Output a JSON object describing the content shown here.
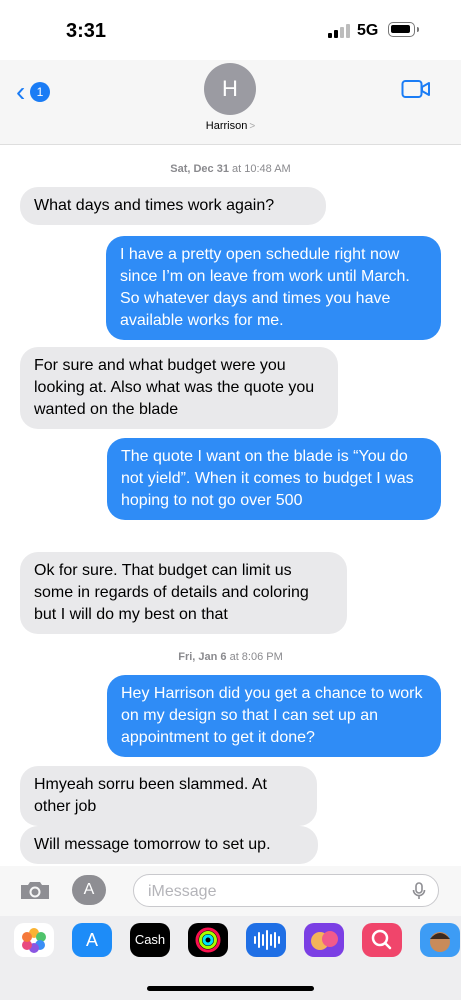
{
  "status": {
    "time": "3:31",
    "network": "5G"
  },
  "nav": {
    "back_badge": "1",
    "avatar_initial": "H",
    "contact_name": "Harrison",
    "contact_chevron": ">"
  },
  "messages": [
    {
      "type": "stamp",
      "day": "Sat, Dec 31",
      "time": "at 10:48 AM"
    },
    {
      "type": "in",
      "text": "What days and times work again?"
    },
    {
      "type": "out",
      "text": "I have a pretty open schedule right now since I’m on leave from work until March. So whatever days and times you have available works for me."
    },
    {
      "type": "in",
      "text": "For sure and what budget were you looking at. Also what was the quote you wanted on the blade"
    },
    {
      "type": "out",
      "text": "The quote I want on the blade is “You do not yield”. When it comes to budget I was hoping to not go over 500"
    },
    {
      "type": "in",
      "text": "Ok for sure. That budget can limit us some in regards of details and coloring but I will do my best on that"
    },
    {
      "type": "stamp",
      "day": "Fri, Jan 6",
      "time": "at 8:06 PM"
    },
    {
      "type": "out",
      "text": "Hey Harrison did you get a chance to work on my design so that I can set up an appointment to get it done?"
    },
    {
      "type": "in",
      "text": "Hmyeah sorru been slammed. At other job"
    },
    {
      "type": "in",
      "text": "Will message tomorrow to set up."
    }
  ],
  "input": {
    "placeholder": "iMessage",
    "value": ""
  },
  "apps": [
    {
      "name": "photos-icon"
    },
    {
      "name": "app-store-icon"
    },
    {
      "name": "apple-cash-icon",
      "label": "Cash"
    },
    {
      "name": "activity-icon"
    },
    {
      "name": "audio-message-icon"
    },
    {
      "name": "memoji-stickers-icon"
    },
    {
      "name": "web-search-icon"
    },
    {
      "name": "memoji-icon"
    }
  ],
  "colors": {
    "accent": "#1a7cf5",
    "outgoing": "#2f8cf6",
    "incoming": "#e9e9eb"
  }
}
